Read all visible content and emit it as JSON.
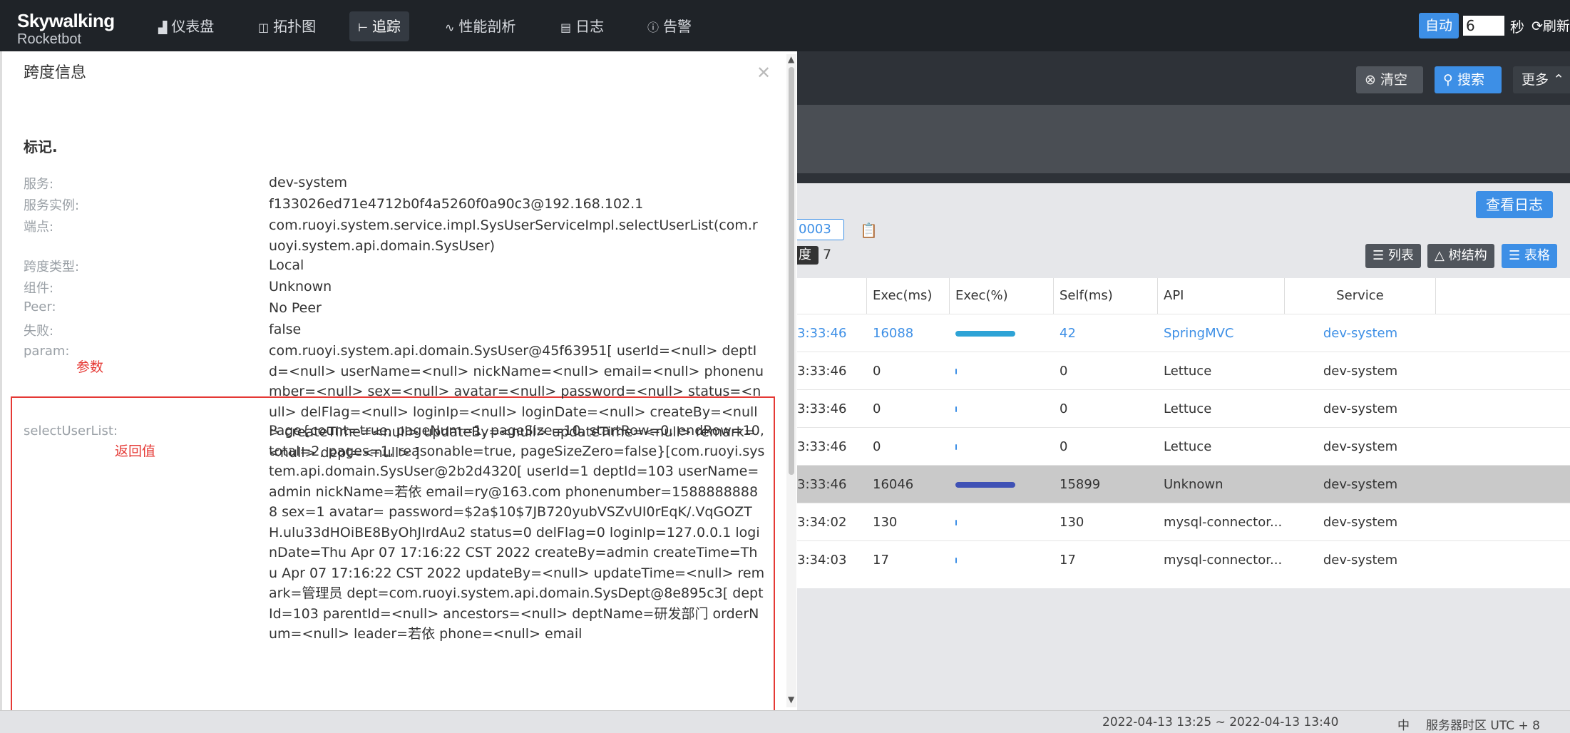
{
  "nav": {
    "logo_main": "Skywalking",
    "logo_sub": "Rocketbot",
    "items": [
      {
        "label": "仪表盘",
        "icon": "chart-icon"
      },
      {
        "label": "拓扑图",
        "icon": "topology-icon"
      },
      {
        "label": "追踪",
        "icon": "trace-icon"
      },
      {
        "label": "性能剖析",
        "icon": "profile-icon"
      },
      {
        "label": "日志",
        "icon": "log-icon"
      },
      {
        "label": "告警",
        "icon": "alarm-icon"
      }
    ],
    "active": "追踪",
    "auto_label": "自动",
    "interval_value": "6",
    "sec_label": "秒",
    "refresh_label": "刷新"
  },
  "toolbar": {
    "clear_label": "清空",
    "search_label": "搜索",
    "more_label": "更多"
  },
  "trace": {
    "view_log_label": "查看日志",
    "trace_id_partial": "0003",
    "depth_label": "度",
    "depth_count": "7",
    "view_list": "列表",
    "view_tree": "树结构",
    "view_table": "表格"
  },
  "table": {
    "headers": [
      "Exec(ms)",
      "Exec(%)",
      "Self(ms)",
      "API",
      "Service"
    ],
    "rows": [
      {
        "time": "3:33:46",
        "exec": "16088",
        "pct": 1.0,
        "self": "42",
        "api": "SpringMVC",
        "service": "dev-system",
        "link": true,
        "highlight": false
      },
      {
        "time": "3:33:46",
        "exec": "0",
        "pct": 0.0,
        "self": "0",
        "api": "Lettuce",
        "service": "dev-system",
        "link": false,
        "highlight": false
      },
      {
        "time": "3:33:46",
        "exec": "0",
        "pct": 0.0,
        "self": "0",
        "api": "Lettuce",
        "service": "dev-system",
        "link": false,
        "highlight": false
      },
      {
        "time": "3:33:46",
        "exec": "0",
        "pct": 0.0,
        "self": "0",
        "api": "Lettuce",
        "service": "dev-system",
        "link": false,
        "highlight": false
      },
      {
        "time": "3:33:46",
        "exec": "16046",
        "pct": 0.997,
        "self": "15899",
        "api": "Unknown",
        "service": "dev-system",
        "link": false,
        "highlight": true
      },
      {
        "time": "3:34:02",
        "exec": "130",
        "pct": 0.008,
        "self": "130",
        "api": "mysql-connector...",
        "service": "dev-system",
        "link": false,
        "highlight": false
      },
      {
        "time": "3:34:03",
        "exec": "17",
        "pct": 0.001,
        "self": "17",
        "api": "mysql-connector...",
        "service": "dev-system",
        "link": false,
        "highlight": false
      }
    ]
  },
  "status": {
    "time_range": "2022-04-13 13:25 ~ 2022-04-13 13:40",
    "lang": "中",
    "timezone": "服务器时区 UTC + 8"
  },
  "drawer": {
    "title": "跨度信息",
    "section_title": "标记.",
    "fields": [
      {
        "label": "服务:",
        "value": "dev-system"
      },
      {
        "label": "服务实例:",
        "value": "f133026ed71e4712b0f4a5260f0a90c3@192.168.102.1"
      },
      {
        "label": "端点:",
        "value": "com.ruoyi.system.service.impl.SysUserServiceImpl.selectUserList(com.ruoyi.system.api.domain.SysUser)"
      },
      {
        "label": "跨度类型:",
        "value": "Local"
      },
      {
        "label": "组件:",
        "value": "Unknown"
      },
      {
        "label": "Peer:",
        "value": "No Peer"
      },
      {
        "label": "失败:",
        "value": "false"
      }
    ],
    "param_label": "param:",
    "param_value": "com.ruoyi.system.api.domain.SysUser@45f63951[ userId=<null> deptId=<null> userName=<null> nickName=<null> email=<null> phonenumber=<null> sex=<null> avatar=<null> password=<null> status=<null> delFlag=<null> loginIp=<null> loginDate=<null> createBy=<null> createTime=<null> updateBy=<null> updateTime=<null> remark=<null> dept=<null> ]",
    "param_note": "参数",
    "return_label": "selectUserList:",
    "return_value": "Page{count=true, pageNum=1, pageSize=10, startRow=0, endRow=10, total=2, pages=1, reasonable=true, pageSizeZero=false}[com.ruoyi.system.api.domain.SysUser@2b2d4320[ userId=1 deptId=103 userName=admin nickName=若依 email=ry@163.com phonenumber=15888888888 sex=1 avatar= password=$2a$10$7JB720yubVSZvUI0rEqK/.VqGOZTH.ulu33dHOiBE8ByOhJIrdAu2 status=0 delFlag=0 loginIp=127.0.0.1 loginDate=Thu Apr 07 17:16:22 CST 2022 createBy=admin createTime=Thu Apr 07 17:16:22 CST 2022 updateBy=<null> updateTime=<null> remark=管理员 dept=com.ruoyi.system.api.domain.SysDept@8e895c3[ deptId=103 parentId=<null> ancestors=<null> deptName=研发部门 orderNum=<null> leader=若依 phone=<null> email",
    "return_note": "返回值"
  }
}
